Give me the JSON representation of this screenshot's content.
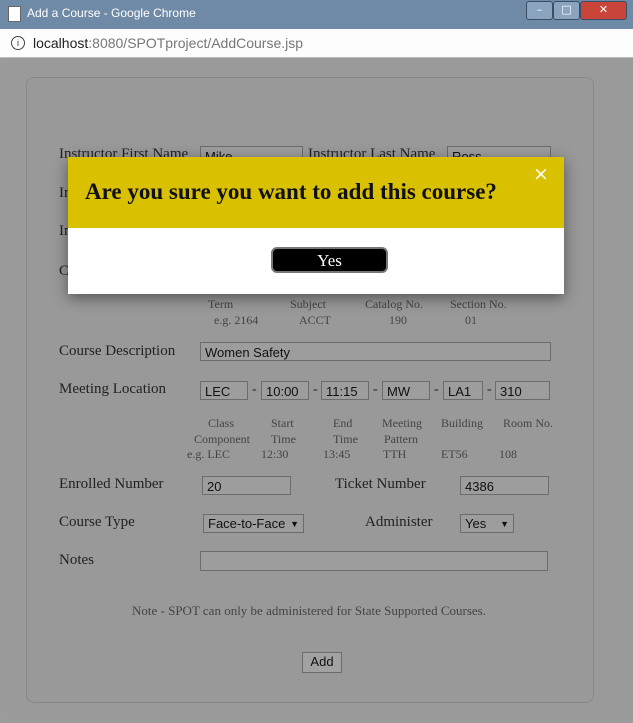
{
  "window": {
    "title": "Add a Course - Google Chrome"
  },
  "address": {
    "host": "localhost",
    "rest": ":8080/SPOTproject/AddCourse.jsp"
  },
  "form": {
    "instructor_first_label": "Instructor First Name",
    "instructor_first_value": "Mike",
    "instructor_last_label": "Instructor Last Name",
    "instructor_last_value": "Ross",
    "row2_label_stub": "In",
    "row3_label_stub": "In",
    "row4_label_stub": "C",
    "course_hints": {
      "term": "Term",
      "term_eg": "e.g. 2164",
      "subject": "Subject",
      "subject_eg": "ACCT",
      "catalog": "Catalog No.",
      "catalog_eg": "190",
      "section": "Section No.",
      "section_eg": "01"
    },
    "course_description_label": "Course Description",
    "course_description_value": "Women Safety",
    "meeting_location_label": "Meeting Location",
    "meeting": {
      "component": "LEC",
      "start": "10:00",
      "end": "11:15",
      "pattern": "MW",
      "building": "LA1",
      "room": "310"
    },
    "meeting_hints": {
      "class": "Class",
      "component": "Component",
      "component_eg": "e.g. LEC",
      "start": "Start",
      "start_time": "Time",
      "start_eg": "12:30",
      "end": "End",
      "end_time": "Time",
      "end_eg": "13:45",
      "meeting": "Meeting",
      "pattern": "Pattern",
      "pattern_eg": "TTH",
      "building": "Building",
      "building_eg": "ET56",
      "room": "Room No.",
      "room_eg": "108"
    },
    "enrolled_label": "Enrolled Number",
    "enrolled_value": "20",
    "ticket_label": "Ticket Number",
    "ticket_value": "4386",
    "course_type_label": "Course Type",
    "course_type_value": "Face-to-Face",
    "administer_label": "Administer",
    "administer_value": "Yes",
    "notes_label": "Notes",
    "notes_value": "",
    "note_text": "Note - SPOT can only be administered for State Supported Courses.",
    "add_button": "Add"
  },
  "modal": {
    "title": "Are you sure you want to add this course?",
    "close": "×",
    "yes_button": "Yes",
    "header_color": "#d9c100"
  }
}
